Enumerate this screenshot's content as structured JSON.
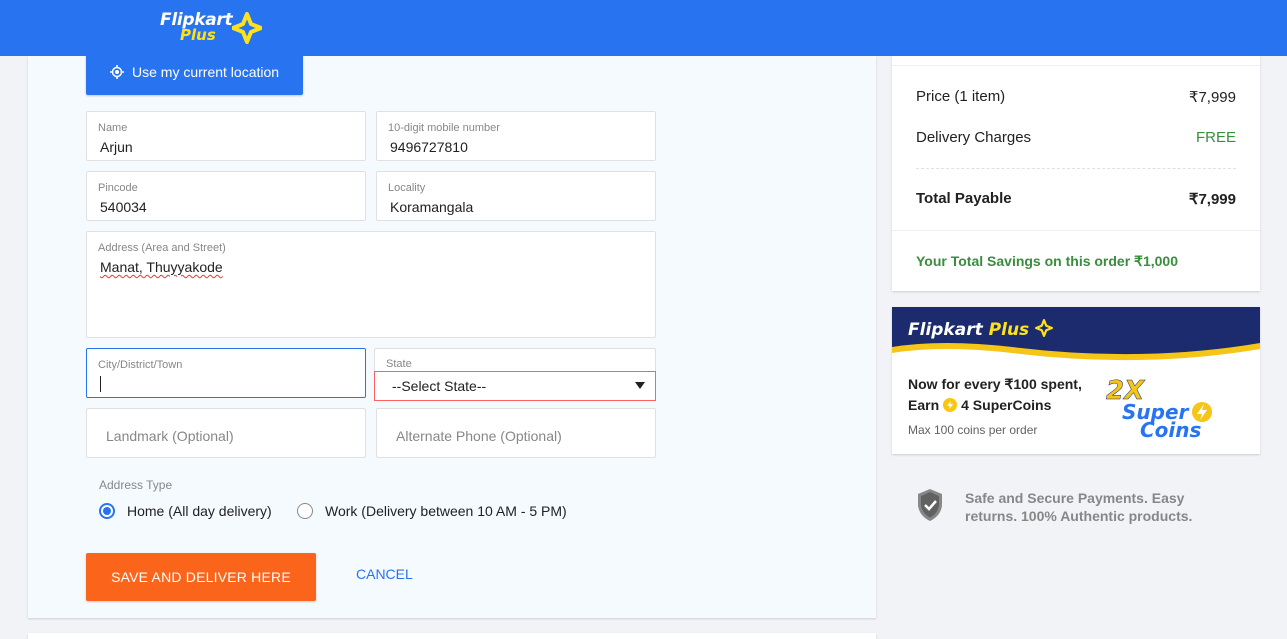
{
  "header": {
    "logo_word": "Flipkart",
    "logo_plus": "Plus",
    "brand_color": "#2874f0"
  },
  "form": {
    "location_button": "Use my current location",
    "name": {
      "label": "Name",
      "value": "Arjun"
    },
    "mobile": {
      "label": "10-digit mobile number",
      "value": "9496727810"
    },
    "pincode": {
      "label": "Pincode",
      "value": "540034"
    },
    "locality": {
      "label": "Locality",
      "value": "Koramangala"
    },
    "address": {
      "label": "Address (Area and Street)",
      "value": "Manat, Thuyyakode"
    },
    "city": {
      "label": "City/District/Town",
      "value": ""
    },
    "state": {
      "label": "State",
      "selected": "--Select State--"
    },
    "landmark": {
      "placeholder": "Landmark (Optional)"
    },
    "alt_phone": {
      "placeholder": "Alternate Phone (Optional)"
    },
    "address_type": {
      "label": "Address Type",
      "options": [
        {
          "label": "Home (All day delivery)",
          "checked": true
        },
        {
          "label": "Work (Delivery between 10 AM - 5 PM)",
          "checked": false
        }
      ]
    },
    "save_label": "SAVE AND DELIVER HERE",
    "cancel_label": "CANCEL",
    "save_color": "#fb641b"
  },
  "price_details": {
    "rows": [
      {
        "label": "Price (1 item)",
        "value": "₹7,999"
      },
      {
        "label": "Delivery Charges",
        "value": "FREE"
      }
    ],
    "total": {
      "label": "Total Payable",
      "value": "₹7,999"
    },
    "savings": "Your Total Savings on this order ₹1,000"
  },
  "plus_offer": {
    "logo_word": "Flipkart",
    "logo_plus": "Plus",
    "line1": "Now for every ₹100 spent,",
    "line2_prefix": "Earn",
    "line2_suffix": "4 SuperCoins",
    "line3": "Max 100 coins per order",
    "badge_multiplier": "2X",
    "badge_word1": "Super",
    "badge_word2": "Coins"
  },
  "secure": {
    "text": "Safe and Secure Payments. Easy returns. 100% Authentic products."
  }
}
